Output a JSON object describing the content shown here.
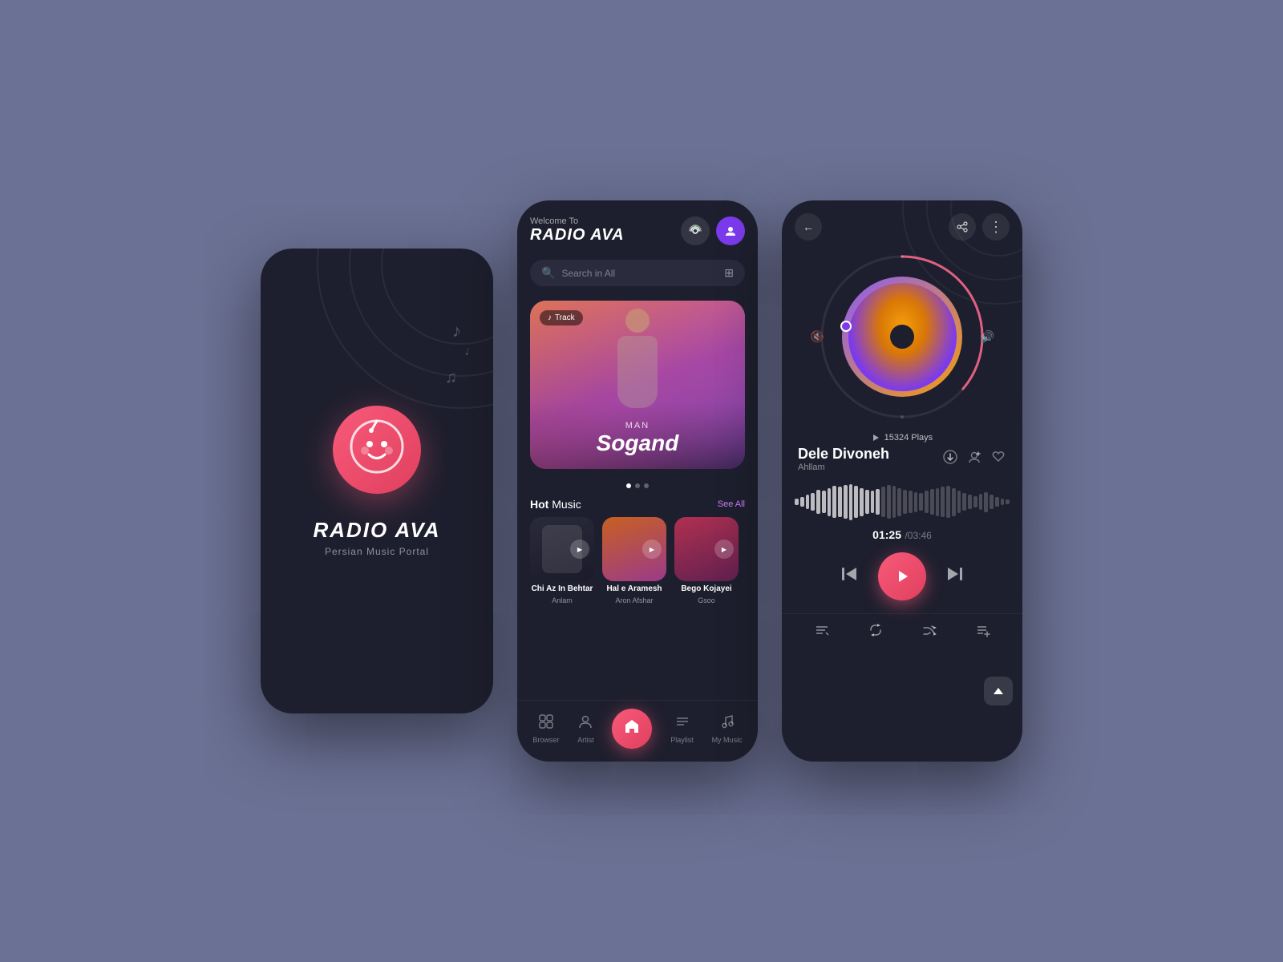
{
  "app": {
    "name": "RADIO AVA",
    "tagline": "Persian Music Portal",
    "welcome": "Welcome To"
  },
  "splash": {
    "brand": "RADIO AVA",
    "subtitle": "Persian Music Portal",
    "logo_emoji": "😊"
  },
  "home": {
    "header": {
      "welcome": "Welcome To",
      "brand": "RADIO AVA",
      "radio_icon": "📻",
      "user_icon": "👤"
    },
    "search": {
      "placeholder": "Search in All",
      "filter_icon": "⚙"
    },
    "featured": {
      "badge": "Track",
      "subtitle": "MAN",
      "title": "Sogand"
    },
    "hot_music": {
      "label": "Hot",
      "label_rest": " Music",
      "see_all": "See All",
      "tracks": [
        {
          "name": "Chi Az In Behtar",
          "artist": "Anlam"
        },
        {
          "name": "Hal e Aramesh",
          "artist": "Aron Afshar"
        },
        {
          "name": "Bego Kojayei",
          "artist": "Gsoo"
        }
      ]
    },
    "nav": {
      "items": [
        {
          "id": "browser",
          "label": "Browser",
          "icon": "⊞"
        },
        {
          "id": "artist",
          "label": "Artist",
          "icon": "♪"
        },
        {
          "id": "home",
          "label": "",
          "icon": "⌂"
        },
        {
          "id": "playlist",
          "label": "Playlist",
          "icon": "≡"
        },
        {
          "id": "mymusic",
          "label": "My Music",
          "icon": "♫"
        }
      ]
    }
  },
  "player": {
    "back_icon": "←",
    "share_icon": "⋯",
    "more_icon": "⋮",
    "plays": "15324 Plays",
    "track_name": "Dele Divoneh",
    "artist": "Ahllam",
    "time_current": "01:25",
    "time_separator": "/",
    "time_total": "03:46",
    "waveform_bars": 40,
    "active_bars": 16,
    "controls": {
      "prev": "⏮",
      "play": "▶",
      "next": "⏭"
    },
    "bottom": {
      "lyrics": "≡",
      "repeat": "↺",
      "shuffle": "⇌",
      "add_queue": "≡+"
    },
    "actions": {
      "download": "↓",
      "add_user": "👤+",
      "like": "♡"
    }
  },
  "colors": {
    "pink": "#f85a7a",
    "purple": "#7c3aed",
    "bg_dark": "#1e1f2e",
    "bg_medium": "#2a2b3d",
    "text_muted": "rgba(255,255,255,0.4)",
    "accent_purple": "#c97ff5"
  }
}
